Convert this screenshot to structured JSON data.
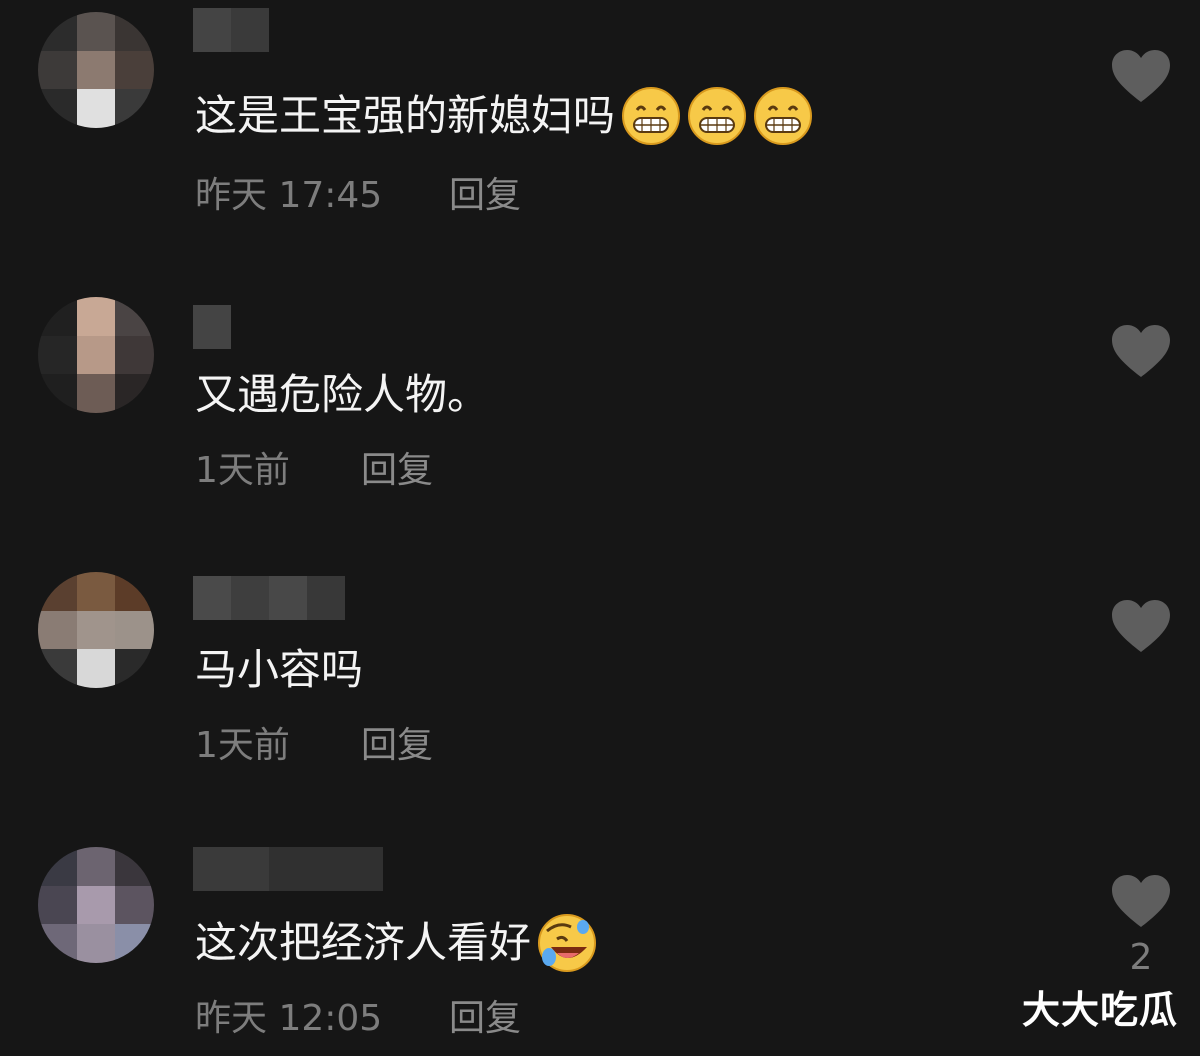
{
  "comments": [
    {
      "text": "这是王宝强的新媳妇吗",
      "emojis": [
        "grin-emoji",
        "grin-emoji",
        "grin-emoji"
      ],
      "time": "昨天 17:45",
      "reply_label": "回复",
      "likes": ""
    },
    {
      "text": "又遇危险人物。",
      "emojis": [],
      "time": "1天前",
      "reply_label": "回复",
      "likes": ""
    },
    {
      "text": "马小容吗",
      "emojis": [],
      "time": "1天前",
      "reply_label": "回复",
      "likes": ""
    },
    {
      "text": "这次把经济人看好",
      "emojis": [
        "rolling-laugh-emoji"
      ],
      "time": "昨天 12:05",
      "reply_label": "回复",
      "likes": "2"
    }
  ],
  "watermark": "大大吃瓜",
  "colors": {
    "background": "#161616",
    "text": "#f4f4f4",
    "meta": "#7d7d7d",
    "like_icon": "#5e5e5e"
  }
}
